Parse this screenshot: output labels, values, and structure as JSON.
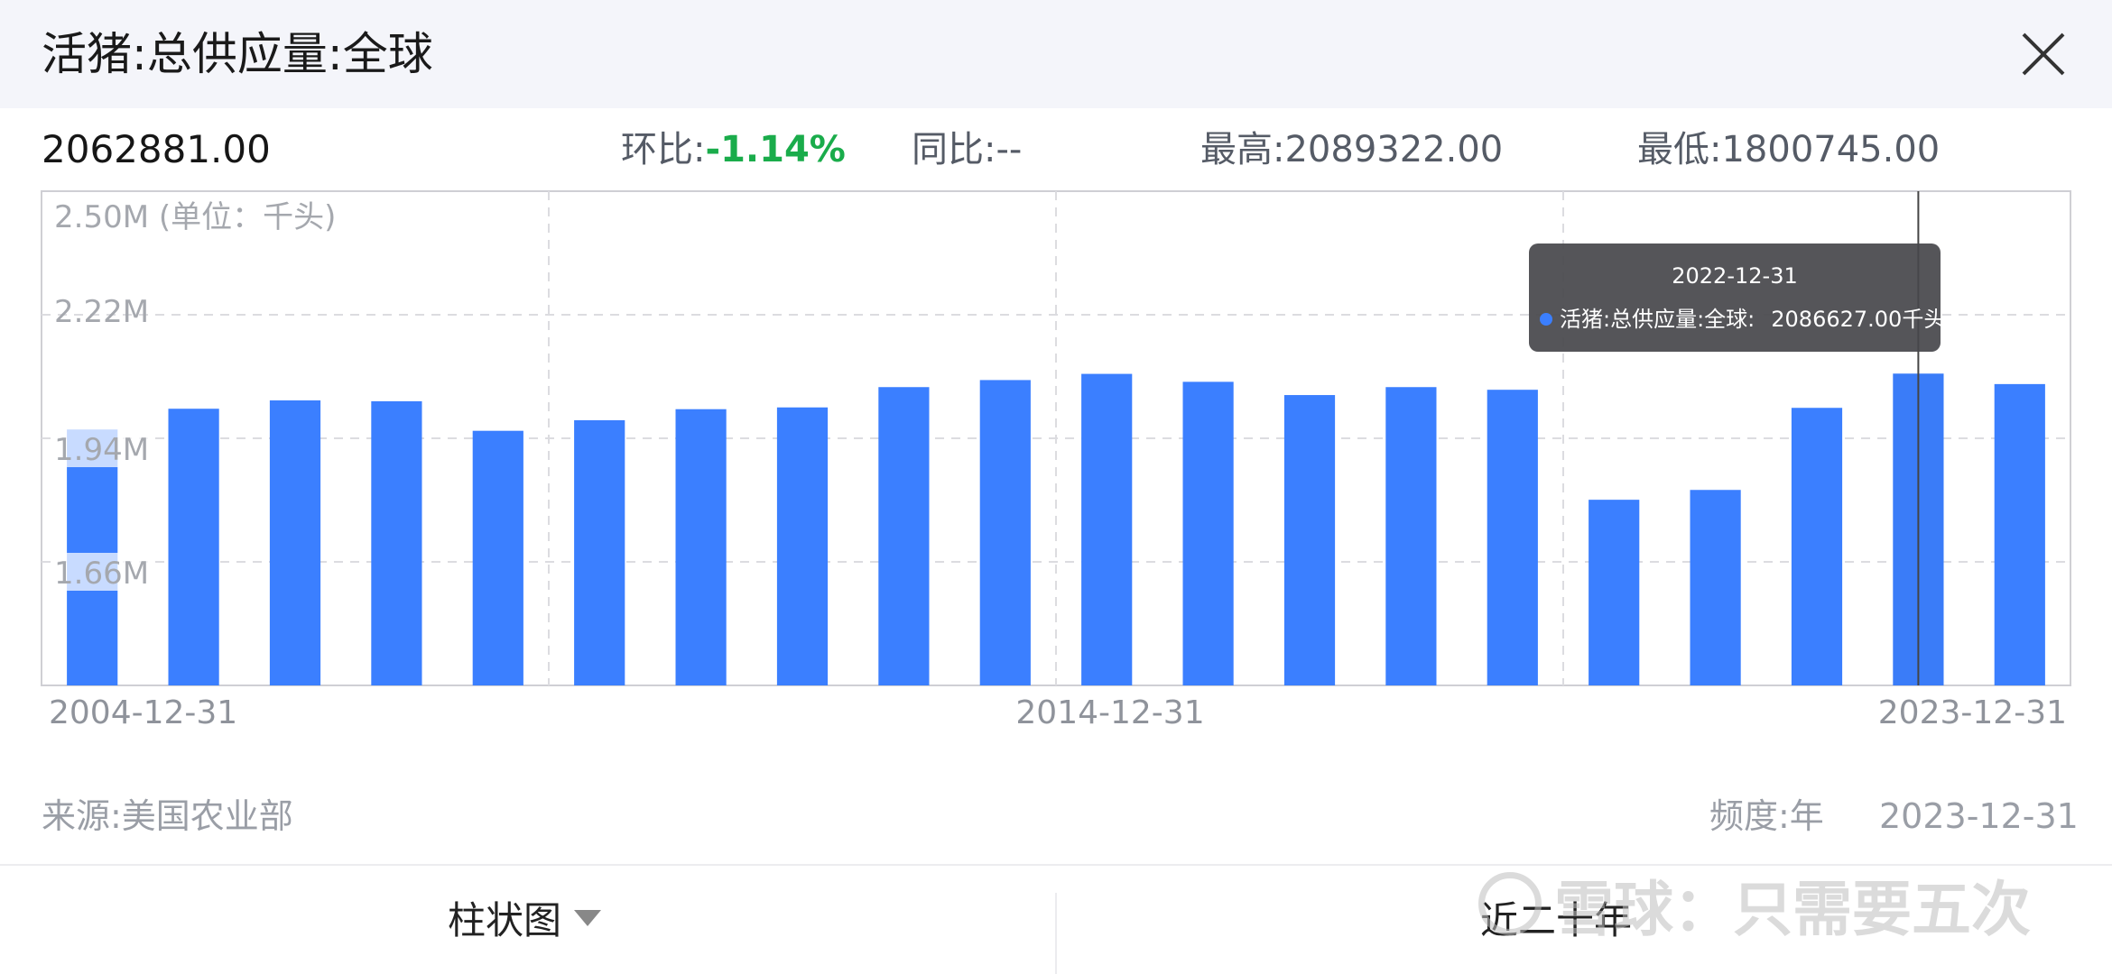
{
  "header": {
    "title": "活猪:总供应量:全球"
  },
  "stats": {
    "current": "2062881.00",
    "hb_label": "环比:",
    "hb_value": "-1.14%",
    "yoy": "同比:--",
    "high": "最高:2089322.00",
    "low": "最低:1800745.00"
  },
  "tooltip": {
    "date": "2022-12-31",
    "series": "活猪:总供应量:全球:",
    "value": "2086627.00千头"
  },
  "footer": {
    "source": "来源:美国农业部",
    "frequency": "频度:年",
    "date": "2023-12-31"
  },
  "bottom_bar": {
    "chart_type": "柱状图",
    "range": "近二十年"
  },
  "watermark": "雪球：只需要五次",
  "colors": {
    "bar": "#3b7fff",
    "up": "#1aac4b",
    "tooltip_bg": "#46464b"
  },
  "icons": {
    "close": "close-icon",
    "dropdown": "caret-down-icon"
  },
  "chart_data": {
    "type": "bar",
    "unit_label": "2.50M (单位：千头)",
    "x_tick_labels": [
      "2004-12-31",
      "2014-12-31",
      "2023-12-31"
    ],
    "y_tick_labels": [
      "2.22M",
      "1.94M",
      "1.66M"
    ],
    "ylim": [
      1380000,
      2500000
    ],
    "y_ticks": [
      2220000,
      1940000,
      1660000
    ],
    "x": [
      "2004-12-31",
      "2005-12-31",
      "2006-12-31",
      "2007-12-31",
      "2008-12-31",
      "2009-12-31",
      "2010-12-31",
      "2011-12-31",
      "2012-12-31",
      "2013-12-31",
      "2014-12-31",
      "2015-12-31",
      "2016-12-31",
      "2017-12-31",
      "2018-12-31",
      "2019-12-31",
      "2020-12-31",
      "2021-12-31",
      "2022-12-31",
      "2023-12-31"
    ],
    "values": [
      1960000,
      2007000,
      2026000,
      2024000,
      1957000,
      1981000,
      2006000,
      2010000,
      2056000,
      2072000,
      2086000,
      2068000,
      2038000,
      2056000,
      2050000,
      1800745,
      1823000,
      2009000,
      2086627,
      2062881
    ],
    "highlight": "2022-12-31",
    "grid": true
  }
}
